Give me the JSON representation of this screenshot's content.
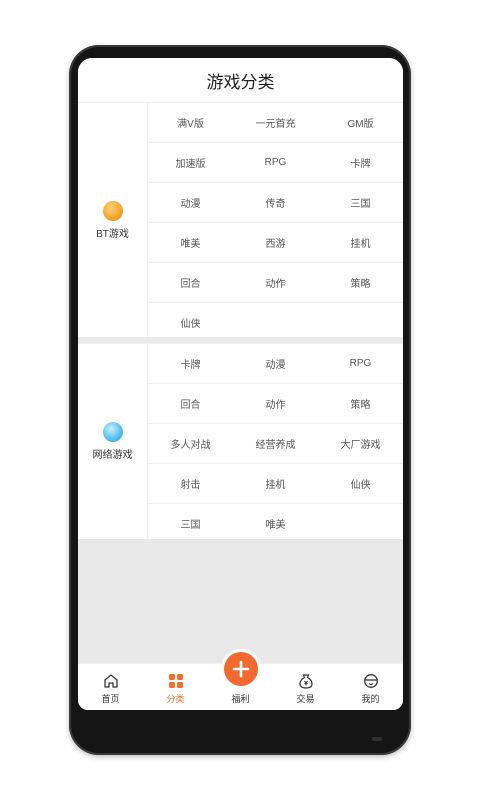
{
  "header": {
    "title": "游戏分类"
  },
  "bt_section": {
    "label": "BT游戏",
    "icon": "bt-game-icon",
    "items": [
      "满V版",
      "一元首充",
      "GM版",
      "加速版",
      "RPG",
      "卡牌",
      "动漫",
      "传奇",
      "三国",
      "唯美",
      "西游",
      "挂机",
      "回合",
      "动作",
      "策略",
      "仙侠"
    ]
  },
  "net_section": {
    "label": "网络游戏",
    "icon": "net-game-icon",
    "items": [
      "卡牌",
      "动漫",
      "RPG",
      "回合",
      "动作",
      "策略",
      "多人对战",
      "经营养成",
      "大厂游戏",
      "射击",
      "挂机",
      "仙侠",
      "三国",
      "唯美"
    ]
  },
  "tabbar": {
    "items": [
      {
        "label": "首页",
        "icon": "home-icon"
      },
      {
        "label": "分类",
        "icon": "grid-icon"
      },
      {
        "label": "福利",
        "icon": "plus-icon"
      },
      {
        "label": "交易",
        "icon": "money-bag-icon"
      },
      {
        "label": "我的",
        "icon": "user-icon"
      }
    ],
    "active_color": "#f36f2b"
  }
}
